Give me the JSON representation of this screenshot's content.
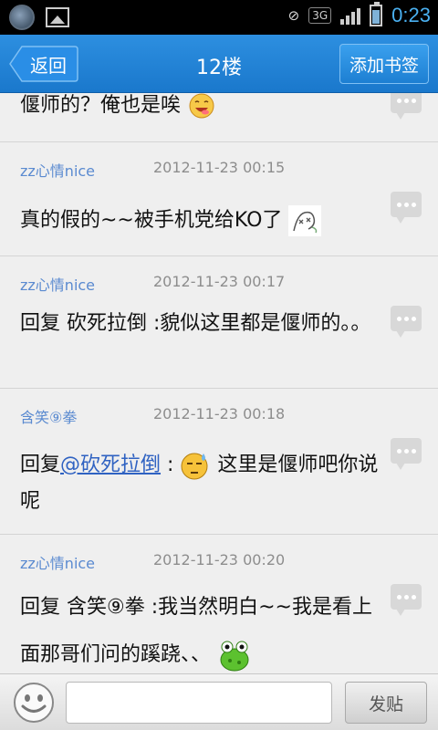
{
  "status_bar": {
    "clock": "0:23",
    "network": "3G",
    "data_indicator": "3G 1X",
    "battery_level": 0.75,
    "signal_bars": 4
  },
  "header": {
    "back_label": "返回",
    "title": "12楼",
    "bookmark_label": "添加书签"
  },
  "posts": [
    {
      "author": "",
      "time": "",
      "content": "偃师的？俺也是唉",
      "emoji": "grin-emoji"
    },
    {
      "author": "zz心情nice",
      "time": "2012-11-23 00:15",
      "content": "真的假的~~被手机党给KO了",
      "emoji": "knockout-emoji"
    },
    {
      "author": "zz心情nice",
      "time": "2012-11-23 00:17",
      "content": "回复 砍死拉倒 :貌似这里都是偃师的。。"
    },
    {
      "author": "含笑⑨拳",
      "time": "2012-11-23 00:18",
      "content_prefix": "回复",
      "mention": "@砍死拉倒",
      "content_mid": " :",
      "content_suffix": " 这里是偃师吧你说呢",
      "emoji": "sweat-emoji"
    },
    {
      "author": "zz心情nice",
      "time": "2012-11-23 00:20",
      "content": "回复 含笑⑨拳 :我当然明白~~我是看上面那哥们问的蹊跷、、",
      "emoji": "frog-emoji"
    }
  ],
  "input_bar": {
    "placeholder": "",
    "send_label": "发贴"
  },
  "colors": {
    "title_bar": "#1a78cc",
    "author": "#5a8ad0",
    "timestamp": "#8d8d8d",
    "clock": "#4ab0f0"
  }
}
